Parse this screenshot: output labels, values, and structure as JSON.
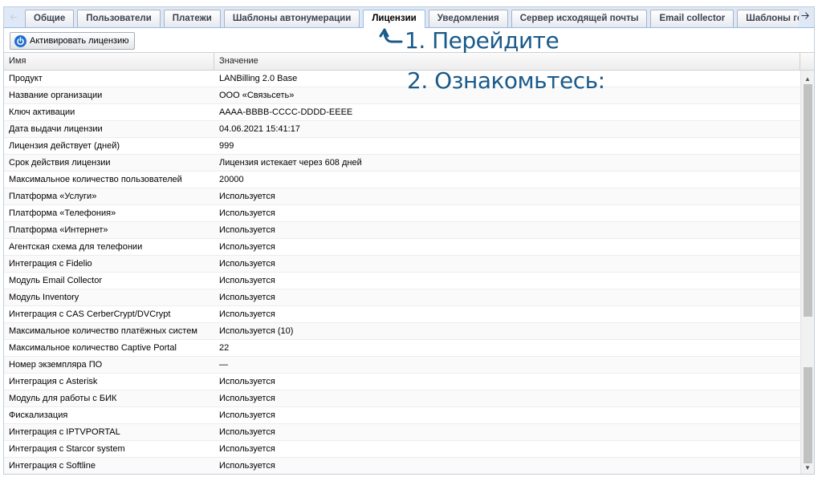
{
  "tabs": [
    {
      "label": "Общие"
    },
    {
      "label": "Пользователи"
    },
    {
      "label": "Платежи"
    },
    {
      "label": "Шаблоны автонумерации"
    },
    {
      "label": "Лицензии",
      "active": true
    },
    {
      "label": "Уведомления"
    },
    {
      "label": "Сервер исходящей почты"
    },
    {
      "label": "Email collector"
    },
    {
      "label": "Шаблоны генер"
    }
  ],
  "toolbar": {
    "activate_label": "Активировать лицензию",
    "activate_icon": "power-icon"
  },
  "annotations": {
    "step1": "1. Перейдите",
    "step2": "2. Ознакомьтесь:",
    "color": "#1a5a8a"
  },
  "grid": {
    "columns": {
      "name": "Имя",
      "value": "Значение"
    },
    "rows": [
      {
        "name": "Продукт",
        "value": "LANBilling 2.0 Base"
      },
      {
        "name": "Название организации",
        "value": "ООО «Связьсеть»"
      },
      {
        "name": "Ключ активации",
        "value": "AAAA-BBBB-CCCC-DDDD-EEEE"
      },
      {
        "name": "Дата выдачи лицензии",
        "value": "04.06.2021 15:41:17"
      },
      {
        "name": "Лицензия действует (дней)",
        "value": "999"
      },
      {
        "name": "Срок действия лицензии",
        "value": "Лицензия истекает через 608 дней"
      },
      {
        "name": "Максимальное количество пользователей",
        "value": "20000"
      },
      {
        "name": "Платформа «Услуги»",
        "value": "Используется"
      },
      {
        "name": "Платформа «Телефония»",
        "value": "Используется"
      },
      {
        "name": "Платформа «Интернет»",
        "value": "Используется"
      },
      {
        "name": "Агентская схема для телефонии",
        "value": "Используется"
      },
      {
        "name": "Интеграция с Fidelio",
        "value": "Используется"
      },
      {
        "name": "Модуль Email Collector",
        "value": "Используется"
      },
      {
        "name": "Модуль Inventory",
        "value": "Используется"
      },
      {
        "name": "Интеграция с CAS CerberCrypt/DVCrypt",
        "value": "Используется"
      },
      {
        "name": "Максимальное количество платёжных систем",
        "value": "Используется (10)"
      },
      {
        "name": "Максимальное количество Captive Portal",
        "value": "22"
      },
      {
        "name": "Номер экземпляра ПО",
        "value": "—"
      },
      {
        "name": "Интеграция с Asterisk",
        "value": "Используется"
      },
      {
        "name": "Модуль для работы с БИК",
        "value": "Используется"
      },
      {
        "name": "Фискализация",
        "value": "Используется"
      },
      {
        "name": "Интеграция с IPTVPORTAL",
        "value": "Используется"
      },
      {
        "name": "Интеграция с Starcor system",
        "value": "Используется"
      },
      {
        "name": "Интеграция с Softline",
        "value": "Используется"
      }
    ]
  }
}
